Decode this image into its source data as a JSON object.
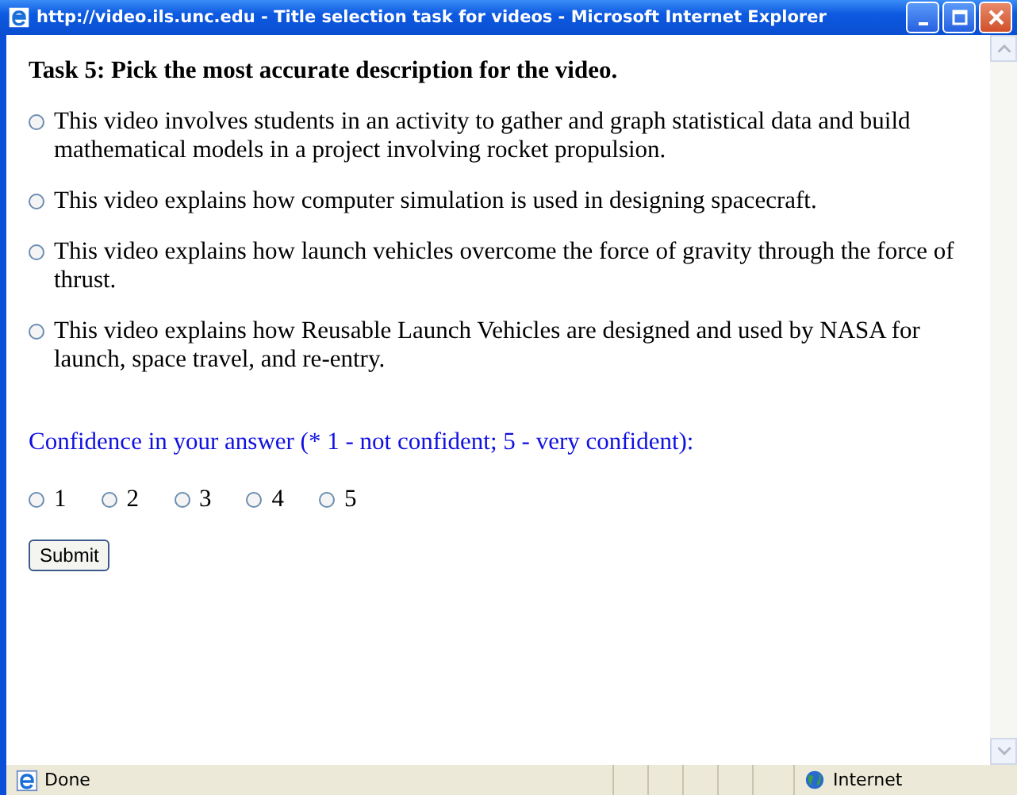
{
  "window": {
    "title": "http://video.ils.unc.edu - Title selection task for videos - Microsoft Internet Explorer"
  },
  "task": {
    "title": "Task 5: Pick the most accurate description for the video.",
    "options": [
      {
        "label": "This video involves students in an activity to gather and graph statistical data and build mathematical models in a project involving rocket propulsion.",
        "selected": false
      },
      {
        "label": "This video explains how computer simulation is used in designing spacecraft.",
        "selected": false
      },
      {
        "label": "This video explains how launch vehicles overcome the force of gravity through the force of thrust.",
        "selected": false
      },
      {
        "label": "This video explains how Reusable Launch Vehicles are designed and used by NASA for launch, space travel, and re-entry.",
        "selected": false
      }
    ]
  },
  "confidence": {
    "prompt": "Confidence in your answer (* 1 - not confident; 5 - very confident):",
    "ratings": [
      {
        "label": "1",
        "selected": false
      },
      {
        "label": "2",
        "selected": false
      },
      {
        "label": "3",
        "selected": false
      },
      {
        "label": "4",
        "selected": false
      },
      {
        "label": "5",
        "selected": false
      }
    ]
  },
  "submit": "Submit",
  "status_bar": {
    "status": "Done",
    "zone": "Internet"
  }
}
